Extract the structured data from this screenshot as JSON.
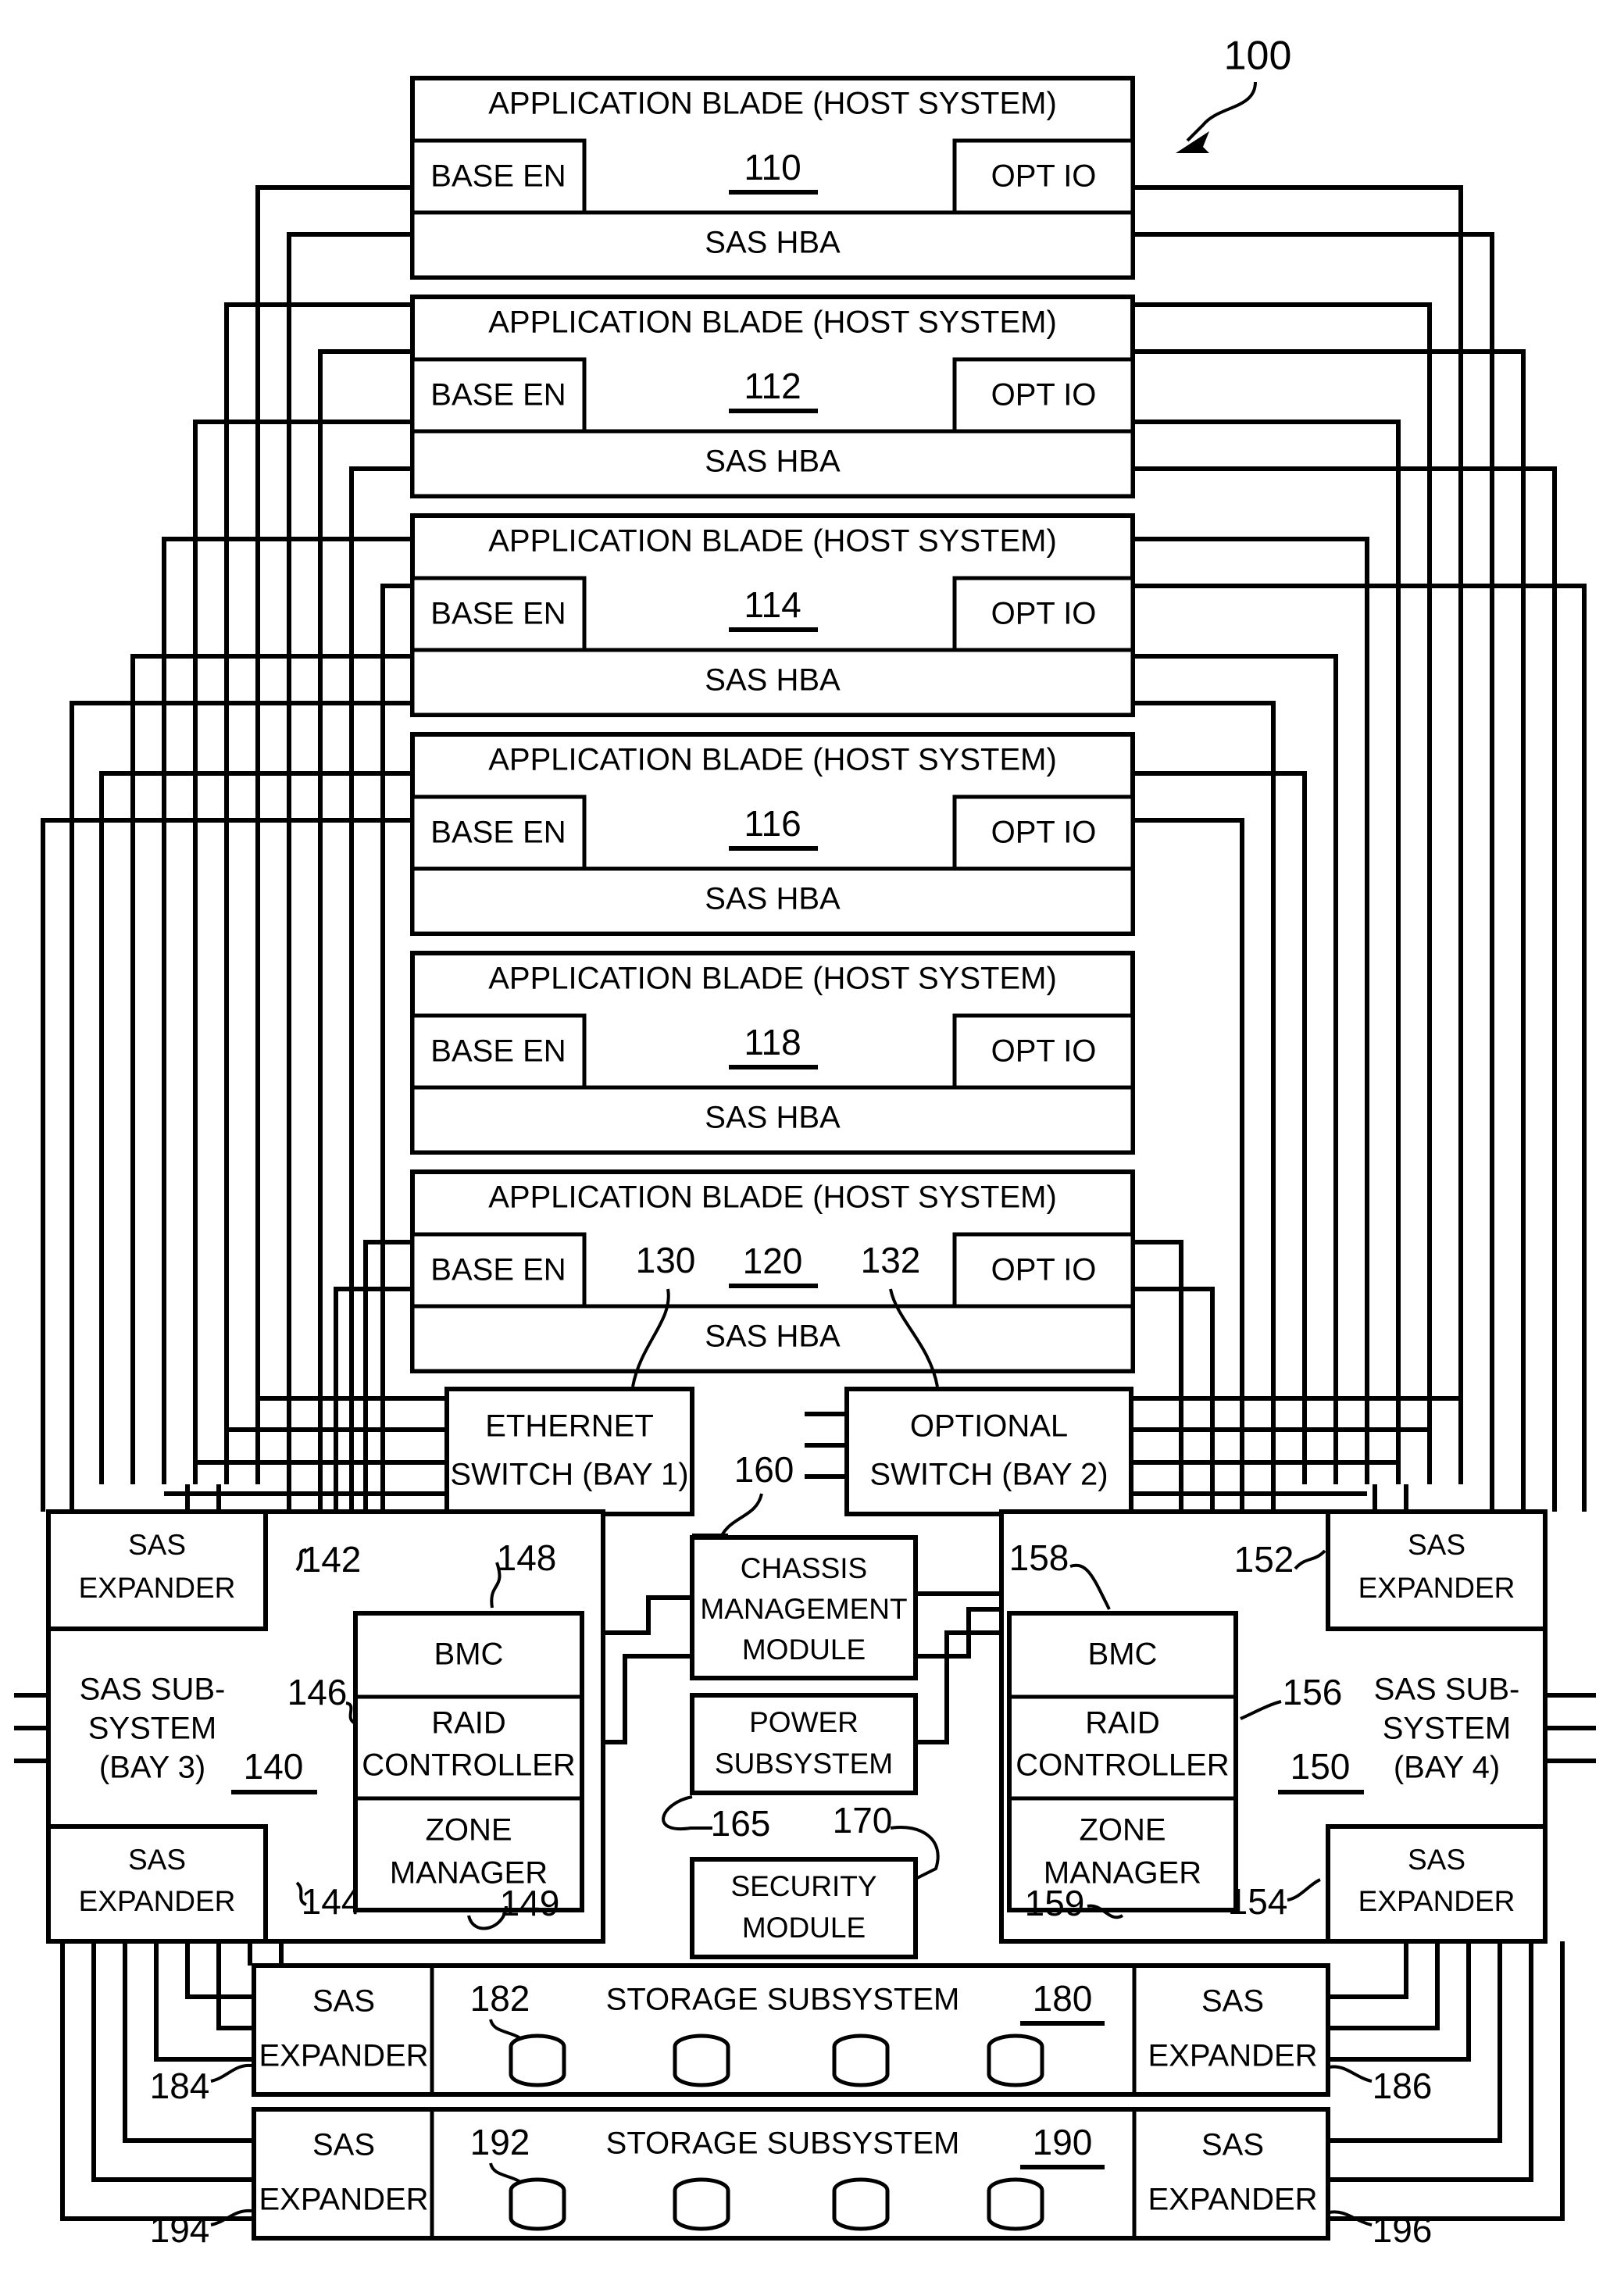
{
  "figure": {
    "ref": "100",
    "arrow": "curved-arrow-pointing-down-left"
  },
  "blades": [
    {
      "title": "APPLICATION BLADE (HOST SYSTEM)",
      "ref": "110",
      "left_port": "BASE EN",
      "right_port": "OPT IO",
      "hba": "SAS HBA"
    },
    {
      "title": "APPLICATION BLADE (HOST SYSTEM)",
      "ref": "112",
      "left_port": "BASE EN",
      "right_port": "OPT IO",
      "hba": "SAS HBA"
    },
    {
      "title": "APPLICATION BLADE (HOST SYSTEM)",
      "ref": "114",
      "left_port": "BASE EN",
      "right_port": "OPT IO",
      "hba": "SAS HBA"
    },
    {
      "title": "APPLICATION BLADE (HOST SYSTEM)",
      "ref": "116",
      "left_port": "BASE EN",
      "right_port": "OPT IO",
      "hba": "SAS HBA"
    },
    {
      "title": "APPLICATION BLADE (HOST SYSTEM)",
      "ref": "118",
      "left_port": "BASE EN",
      "right_port": "OPT IO",
      "hba": "SAS HBA"
    },
    {
      "title": "APPLICATION BLADE (HOST SYSTEM)",
      "ref": "120",
      "left_port": "BASE EN",
      "right_port": "OPT IO",
      "hba": "SAS HBA"
    }
  ],
  "blade_callouts": {
    "base_en_ref": "130",
    "opt_io_ref": "132"
  },
  "switches": {
    "ethernet": {
      "line1": "ETHERNET",
      "line2": "SWITCH (BAY 1)"
    },
    "optional": {
      "line1": "OPTIONAL",
      "line2": "SWITCH (BAY 2)"
    },
    "ref": "160"
  },
  "sas_subsystem_left": {
    "label_line1": "SAS SUB-",
    "label_line2": "SYSTEM",
    "label_line3": "(BAY 3)",
    "ref": "140",
    "expander_top": {
      "line1": "SAS",
      "line2": "EXPANDER",
      "ref": "142"
    },
    "expander_bottom": {
      "line1": "SAS",
      "line2": "EXPANDER",
      "ref": "144"
    },
    "controller_ref": "146",
    "bmc": {
      "label": "BMC",
      "ref": "148"
    },
    "raid": {
      "line1": "RAID",
      "line2": "CONTROLLER"
    },
    "zone": {
      "line1": "ZONE",
      "line2": "MANAGER",
      "ref": "149"
    }
  },
  "sas_subsystem_right": {
    "label_line1": "SAS SUB-",
    "label_line2": "SYSTEM",
    "label_line3": "(BAY 4)",
    "ref": "150",
    "expander_top": {
      "line1": "SAS",
      "line2": "EXPANDER",
      "ref": "152"
    },
    "expander_bottom": {
      "line1": "SAS",
      "line2": "EXPANDER",
      "ref": "154"
    },
    "controller_ref": "156",
    "bmc": {
      "label": "BMC",
      "ref": "158"
    },
    "raid": {
      "line1": "RAID",
      "line2": "CONTROLLER"
    },
    "zone": {
      "line1": "ZONE",
      "line2": "MANAGER",
      "ref": "159"
    }
  },
  "chassis": {
    "management_module": {
      "line1": "CHASSIS",
      "line2": "MANAGEMENT",
      "line3": "MODULE"
    },
    "power_subsystem": {
      "line1": "POWER",
      "line2": "SUBSYSTEM",
      "ref": "165"
    },
    "security_module": {
      "line1": "SECURITY",
      "line2": "MODULE",
      "ref": "170"
    }
  },
  "storage": [
    {
      "title": "STORAGE SUBSYSTEM",
      "ref": "180",
      "disk_ref": "182",
      "expander_left": {
        "line1": "SAS",
        "line2": "EXPANDER",
        "ref": "184"
      },
      "expander_right": {
        "line1": "SAS",
        "line2": "EXPANDER",
        "ref": "186"
      },
      "disk_count": 4
    },
    {
      "title": "STORAGE SUBSYSTEM",
      "ref": "190",
      "disk_ref": "192",
      "expander_left": {
        "line1": "SAS",
        "line2": "EXPANDER",
        "ref": "194"
      },
      "expander_right": {
        "line1": "SAS",
        "line2": "EXPANDER",
        "ref": "196"
      },
      "disk_count": 4
    }
  ],
  "colors": {
    "line": "#000000",
    "background": "#ffffff"
  }
}
